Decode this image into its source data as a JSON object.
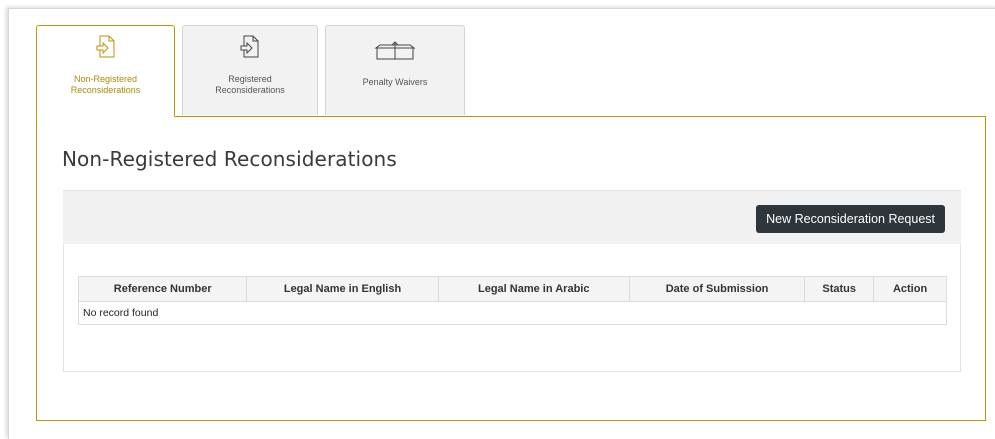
{
  "tabs": [
    {
      "label": "Non-Registered\nReconsiderations",
      "icon": "document-import-icon",
      "active": true
    },
    {
      "label": "Registered\nReconsiderations",
      "icon": "document-import-icon",
      "active": false
    },
    {
      "label": "Penalty Waivers",
      "icon": "box-icon",
      "active": false
    }
  ],
  "main": {
    "title": "Non-Registered Reconsiderations",
    "new_request_label": "New Reconsideration Request"
  },
  "table": {
    "columns": [
      "Reference Number",
      "Legal Name in English",
      "Legal Name in Arabic",
      "Date of Submission",
      "Status",
      "Action"
    ],
    "empty_message": "No record found"
  },
  "colors": {
    "accent": "#b8960a",
    "button_bg": "#2e353b"
  }
}
